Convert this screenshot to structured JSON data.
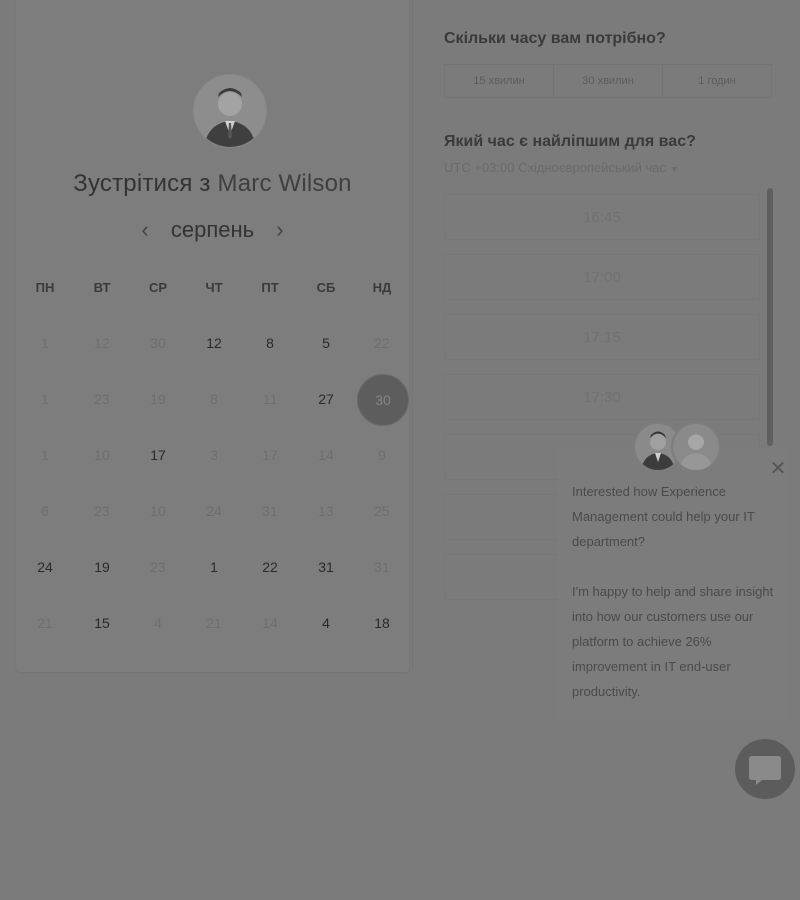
{
  "meeting": {
    "prefix": "Зустрітися з",
    "host": "Marc Wilson"
  },
  "calendar": {
    "month": "серпень",
    "weekdays": [
      "ПН",
      "ВТ",
      "СР",
      "ЧТ",
      "ПТ",
      "СБ",
      "НД"
    ],
    "weeks": [
      [
        "1",
        "12",
        "30",
        "12",
        "8",
        "5",
        "22"
      ],
      [
        "1",
        "23",
        "19",
        "8",
        "11",
        "27",
        "30"
      ],
      [
        "1",
        "10",
        "17",
        "3",
        "17",
        "14",
        "9"
      ],
      [
        "6",
        "23",
        "10",
        "24",
        "31",
        "13",
        "25"
      ],
      [
        "24",
        "19",
        "23",
        "1",
        "22",
        "31",
        "31"
      ],
      [
        "21",
        "15",
        "4",
        "21",
        "14",
        "4",
        "18"
      ]
    ],
    "active": [
      [
        false,
        false,
        false,
        true,
        true,
        true,
        false
      ],
      [
        false,
        false,
        false,
        false,
        false,
        true,
        false
      ],
      [
        false,
        false,
        true,
        false,
        false,
        false,
        false
      ],
      [
        false,
        false,
        false,
        false,
        false,
        false,
        false
      ],
      [
        true,
        true,
        false,
        true,
        true,
        true,
        false
      ],
      [
        false,
        true,
        false,
        false,
        false,
        true,
        true
      ]
    ],
    "selected": {
      "week": 1,
      "day": 6
    }
  },
  "duration": {
    "title": "Скільки часу вам потрібно?",
    "options": [
      "15 хвилин",
      "30 хвилин",
      "1 годин"
    ]
  },
  "time": {
    "title": "Який час є найліпшим для вас?",
    "timezone": "UTC +03:00 Східноєвропейський час",
    "slots": [
      "16:45",
      "17:00",
      "17:15",
      "17:30"
    ]
  },
  "chat": {
    "message_1": "Interested how Experience Management could help your IT department?",
    "message_2": "I'm happy to help and share insight into how our customers use our platform to achieve 26% improvement in IT end-user productivity."
  }
}
